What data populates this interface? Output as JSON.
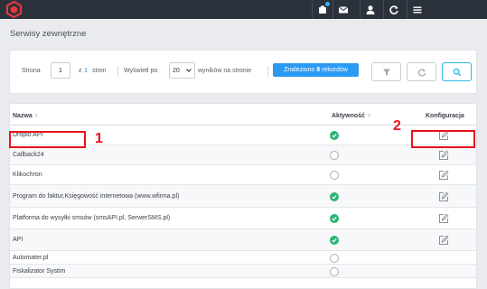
{
  "header": {
    "logo_icon": "app-logo-icon",
    "icons": [
      "notification-icon",
      "mail-icon",
      "user-icon",
      "refresh-icon",
      "menu-icon"
    ]
  },
  "page": {
    "title": "Serwisy zewnętrzne"
  },
  "filter": {
    "page_label": "Strona",
    "page_value": "1",
    "of_label": "z",
    "total_pages": "1",
    "pages_label": "stron",
    "show_label": "Wyświetl po",
    "per_page_value": "20",
    "per_page_suffix": "wyników na stronie",
    "found_prefix": "Znaleziono",
    "found_count": "8",
    "found_suffix": "rekordów"
  },
  "table": {
    "columns": {
      "name": "Nazwa",
      "active": "Aktywność",
      "config": "Konfiguracja"
    },
    "rows": [
      {
        "name": "Droplo API",
        "active": true,
        "configurable": true
      },
      {
        "name": "Callback24",
        "active": false,
        "configurable": true
      },
      {
        "name": "Klikochron",
        "active": false,
        "configurable": true
      },
      {
        "name": "Program do faktur,Księgowość internetowa (www.wfirma.pl)",
        "active": true,
        "configurable": true
      },
      {
        "name": "Platforma do wysyłki smsów (smsAPI.pl, SerwerSMS.pl)",
        "active": true,
        "configurable": true
      },
      {
        "name": "API",
        "active": true,
        "configurable": true
      },
      {
        "name": "Automater.pl",
        "active": false,
        "configurable": false
      },
      {
        "name": "Fiskalizator Systim",
        "active": false,
        "configurable": false
      }
    ]
  },
  "annotations": {
    "first": "1",
    "second": "2",
    "color": "#e8141c"
  }
}
